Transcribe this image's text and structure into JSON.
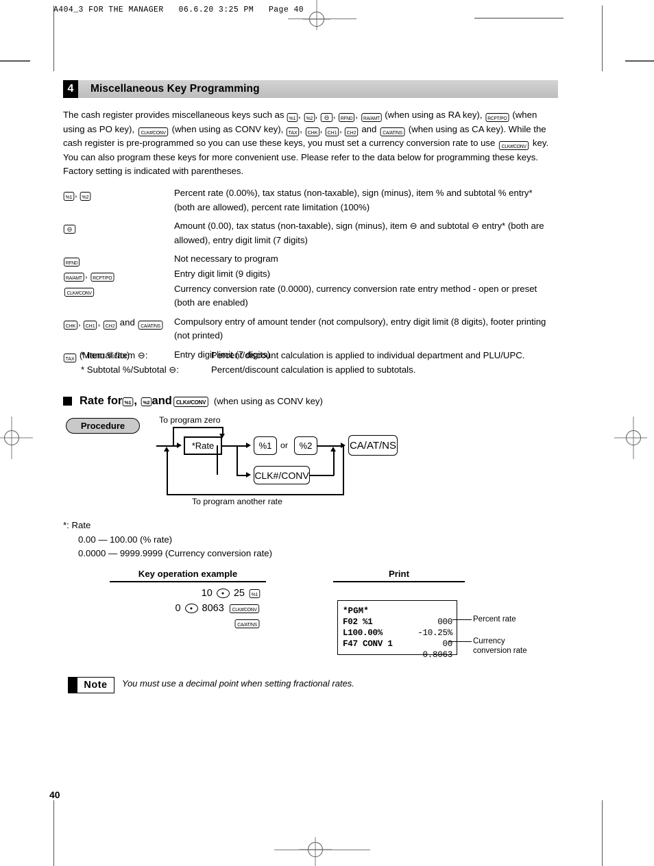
{
  "page_header": "A404_3 FOR THE MANAGER   06.6.20 3:25 PM   Page 40",
  "section": {
    "number": "4",
    "title": "Miscellaneous Key Programming"
  },
  "intro": {
    "t1": "The cash register provides miscellaneous keys such as ",
    "t2": " (when using as RA key), ",
    "t3": " (when using as PO key), ",
    "t4": " (when using as CONV key), ",
    "t5": " and ",
    "t6": " (when using as CA key).  While the cash register is pre-programmed so you can use these keys, you must set a currency conversion rate to use ",
    "t7": " key.  You can also program these keys for more convenient use.  Please refer to the data below for programming these keys. Factory setting is indicated with parentheses."
  },
  "keys": {
    "pct1": "%1",
    "pct2": "%2",
    "minus": "⊖",
    "rfnd": "RFND",
    "raamt": "RA/AMT",
    "rcptpo": "RCPT/PO",
    "clkconv": "CLK#/CONV",
    "tax": "TAX",
    "chk": "CHK",
    "ch1": "CH1",
    "ch2": "CH2",
    "caatns": "CA/AT/NS"
  },
  "key_list": [
    {
      "desc": "Percent rate (0.00%), tax status (non-taxable), sign (minus), item % and subtotal % entry* (both are allowed), percent rate limitation (100%)"
    },
    {
      "desc_a": "Amount (0.00), tax status (non-taxable), sign (minus), item ",
      "desc_b": " and subtotal ",
      "desc_c": " entry* (both are allowed), entry digit limit (7 digits)"
    },
    {
      "desc": "Not necessary to program"
    },
    {
      "desc": "Entry digit limit (9 digits)"
    },
    {
      "desc": "Currency conversion rate (0.0000), currency conversion rate entry method - open or preset (both are enabled)"
    },
    {
      "desc": "Compulsory entry of amount tender (not compulsory), entry digit limit (8 digits), footer printing (not printed)"
    },
    {
      "desc": "Entry digit limit (7 digits)",
      "suffix": "(Manual tax)"
    }
  ],
  "star_notes": [
    {
      "label_a": "* Item %/Item ",
      "label_b": ":",
      "text": "Percent/discount calculation is applied to individual department and PLU/UPC."
    },
    {
      "label_a": "* Subtotal %/Subtotal ",
      "label_b": ":",
      "text": "Percent/discount calculation is applied to subtotals."
    }
  ],
  "rate_section": {
    "heading_a": "Rate for ",
    "heading_comma": ",",
    "heading_and": " and ",
    "heading_suffix": "(when using as CONV key)",
    "procedure_label": "Procedure"
  },
  "flow": {
    "top_label": "To program zero",
    "bottom_label": "To program another rate",
    "rate_box": "*Rate",
    "pct1": "%1",
    "or": "or",
    "pct2": "%2",
    "clkconv": "CLK#/CONV",
    "caatns": "CA/AT/NS"
  },
  "ranges": {
    "title": "*:  Rate",
    "line1": "0.00 — 100.00 (% rate)",
    "line2": "0.0000 — 9999.9999 (Currency conversion rate)"
  },
  "example": {
    "heading": "Key operation example",
    "line1_a": "10",
    "line1_b": "25",
    "line1_key": "%1",
    "line2_a": "0",
    "line2_b": "8063",
    "line2_key": "CLK#/CONV",
    "line3_key": "CA/AT/NS"
  },
  "print": {
    "heading": "Print",
    "title": "*PGM*",
    "rows": [
      {
        "left": "F02 %1",
        "right": "000"
      },
      {
        "left": "L100.00%",
        "right": "-10.25%"
      },
      {
        "left": "F47 CONV 1",
        "right": "00"
      },
      {
        "left": "",
        "right": "0.8063"
      }
    ],
    "callout_percent": "Percent rate",
    "callout_currency_1": "Currency",
    "callout_currency_2": "conversion rate"
  },
  "note": {
    "label": "Note",
    "text": "You must use a decimal point when setting fractional rates."
  },
  "page_number": "40"
}
